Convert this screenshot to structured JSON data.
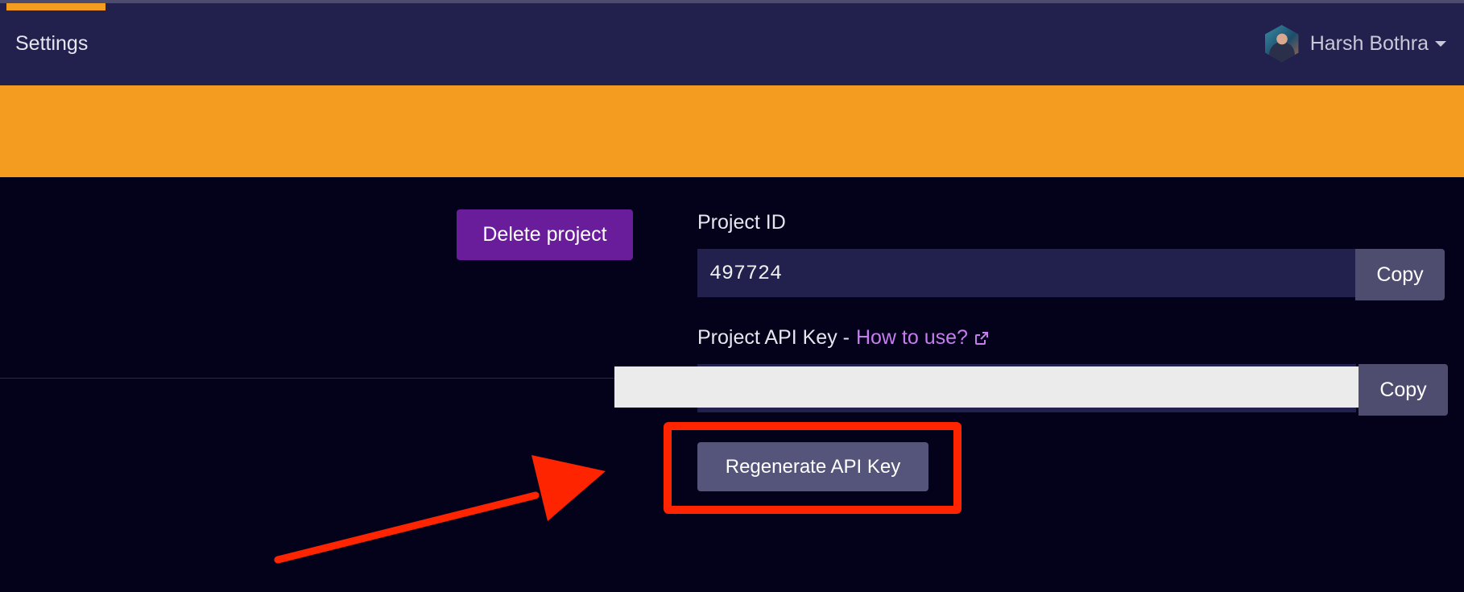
{
  "header": {
    "title": "Settings",
    "user": {
      "name": "Harsh Bothra",
      "avatar_icon": "avatar-icon",
      "dropdown_icon": "chevron-down-icon"
    }
  },
  "colors": {
    "topbar": "#22204d",
    "banner": "#f39c20",
    "background": "#04021a",
    "delete_button": "#6a1d9a",
    "annotation": "#ff2400",
    "link": "#c77cf0"
  },
  "project": {
    "delete_label": "Delete project",
    "id_label": "Project ID",
    "id_value": "497724",
    "api_key_label": "Project API Key -",
    "api_key_link": "How to use?",
    "api_key_link_icon": "external-link-icon",
    "copy_label": "Copy",
    "regenerate_label": "Regenerate API Key"
  }
}
